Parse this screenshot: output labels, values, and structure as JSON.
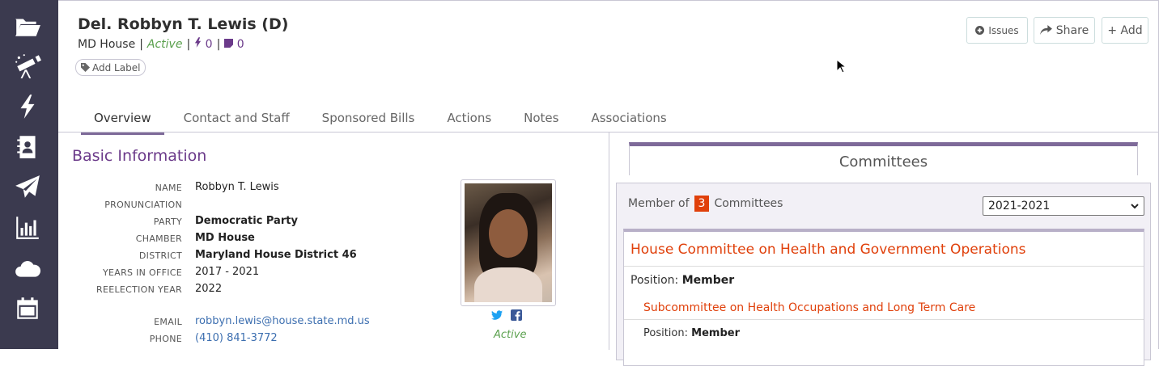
{
  "sidebar": {
    "icons": [
      "folder-open-icon",
      "telescope-icon",
      "bolt-icon",
      "address-book-icon",
      "paper-plane-icon",
      "bar-chart-icon",
      "cloud-icon",
      "calendar-icon"
    ]
  },
  "header": {
    "title": "Del. Robbyn T. Lewis (D)",
    "chamber": "MD House",
    "separator": "|",
    "status": "Active",
    "bolt_count": "0",
    "note_count": "0",
    "add_label": "Add Label"
  },
  "actions": {
    "issues": "Issues",
    "share": "Share",
    "add": "+ Add"
  },
  "tabs": [
    "Overview",
    "Contact and Staff",
    "Sponsored Bills",
    "Actions",
    "Notes",
    "Associations"
  ],
  "basic_info": {
    "title": "Basic Information",
    "name_label": "NAME",
    "name": "Robbyn T. Lewis",
    "pronunciation_label": "PRONUNCIATION",
    "pronunciation": "",
    "party_label": "PARTY",
    "party": "Democratic Party",
    "chamber_label": "CHAMBER",
    "chamber": "MD House",
    "district_label": "DISTRICT",
    "district": "Maryland House District 46",
    "years_label": "YEARS IN OFFICE",
    "years": "2017 - 2021",
    "reelection_label": "REELECTION YEAR",
    "reelection": "2022",
    "email_label": "EMAIL",
    "email": "robbyn.lewis@house.state.md.us",
    "phone_label": "PHONE",
    "phone": "(410) 841-3772",
    "photo_status": "Active"
  },
  "committees": {
    "tab_title": "Committees",
    "member_of": "Member of",
    "count": "3",
    "committees_word": "Committees",
    "year_select": "2021-2021",
    "committee_name": "House Committee on Health and Government Operations",
    "position_label": "Position:",
    "position": "Member",
    "subcommittee_name": "Subcommittee on Health Occupations and Long Term Care",
    "sub_position_label": "Position:",
    "sub_position": "Member"
  },
  "colors": {
    "sidebar_bg": "#3b3a4f",
    "accent_purple": "#6b3a8a",
    "committee_orange": "#e0400b",
    "active_green": "#5aa04d"
  }
}
